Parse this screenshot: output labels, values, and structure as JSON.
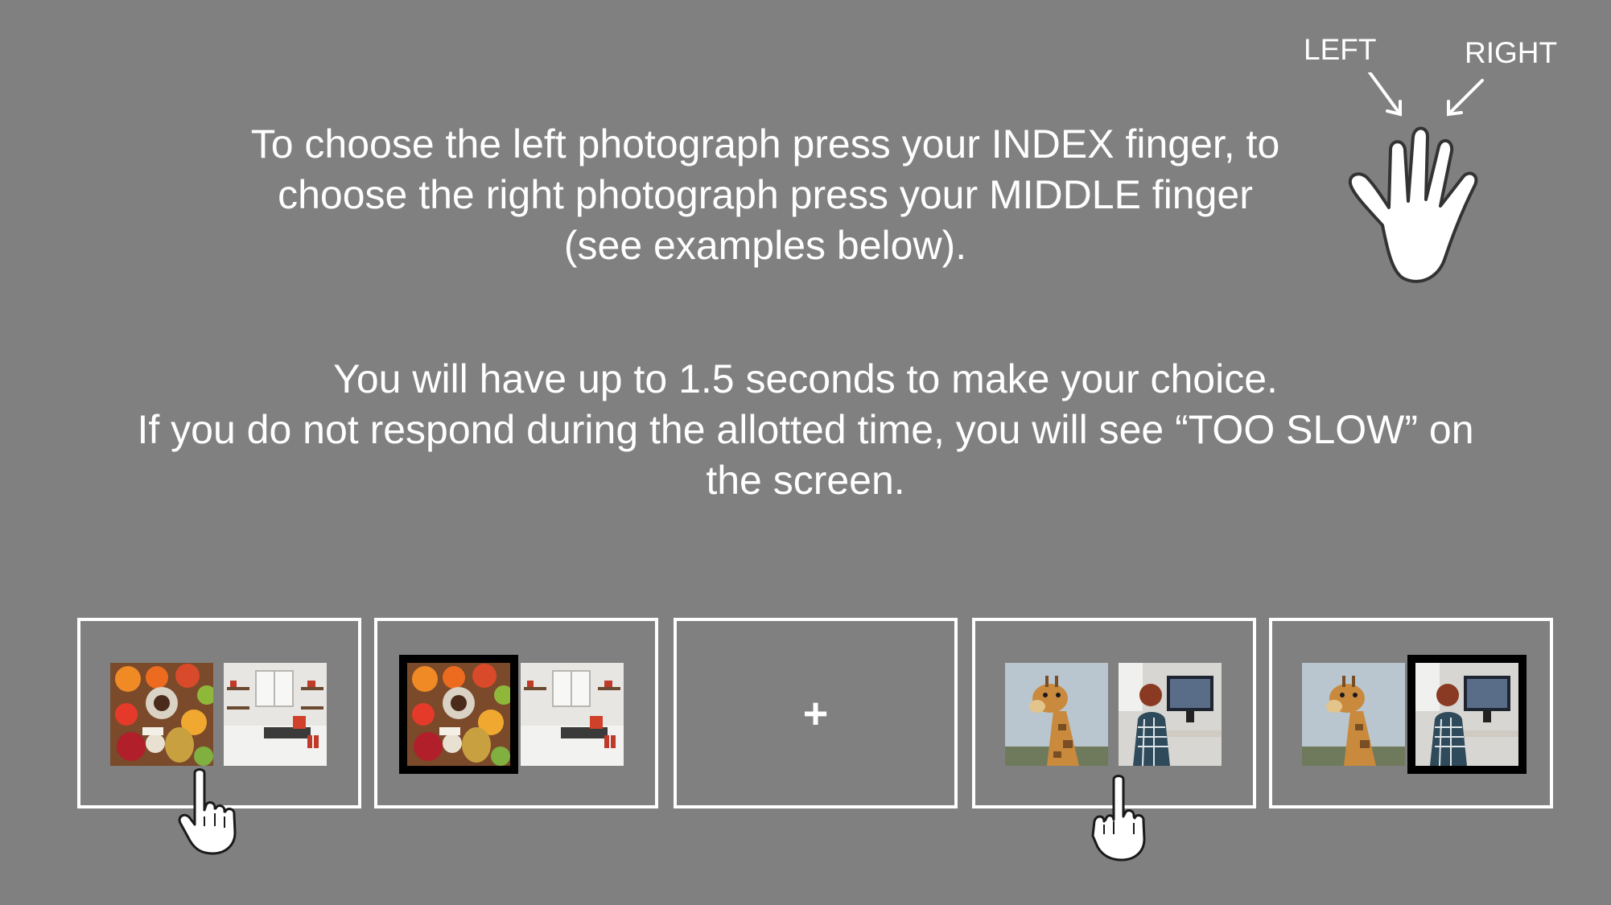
{
  "instructions": {
    "paragraph1": [
      "To choose the left photograph press your INDEX finger, to",
      "choose the right photograph press your MIDDLE finger",
      "(see examples below)."
    ],
    "paragraph2": [
      "You will have up to 1.5 seconds to make your choice.",
      "If you do not respond during the allotted time, you will see “TOO SLOW” on",
      "the screen."
    ]
  },
  "hand_diagram": {
    "left_label": "LEFT",
    "right_label": "RIGHT",
    "icon": "hand-outline-icon"
  },
  "example_trials": [
    {
      "id": "panel-1",
      "left_photo": "food-flatlay-photo",
      "right_photo": "kitchen-photo",
      "selected": null,
      "response": "index-finger"
    },
    {
      "id": "panel-2",
      "left_photo": "food-flatlay-photo",
      "right_photo": "kitchen-photo",
      "selected": "left"
    },
    {
      "id": "panel-3",
      "fixation": "+"
    },
    {
      "id": "panel-4",
      "left_photo": "giraffe-photo",
      "right_photo": "computer-desk-photo",
      "selected": null,
      "response": "middle-finger"
    },
    {
      "id": "panel-5",
      "left_photo": "giraffe-photo",
      "right_photo": "computer-desk-photo",
      "selected": "right"
    }
  ],
  "colors": {
    "background": "#808080",
    "text": "#ffffff",
    "panel_border": "#ffffff",
    "selection_frame": "#000000"
  }
}
